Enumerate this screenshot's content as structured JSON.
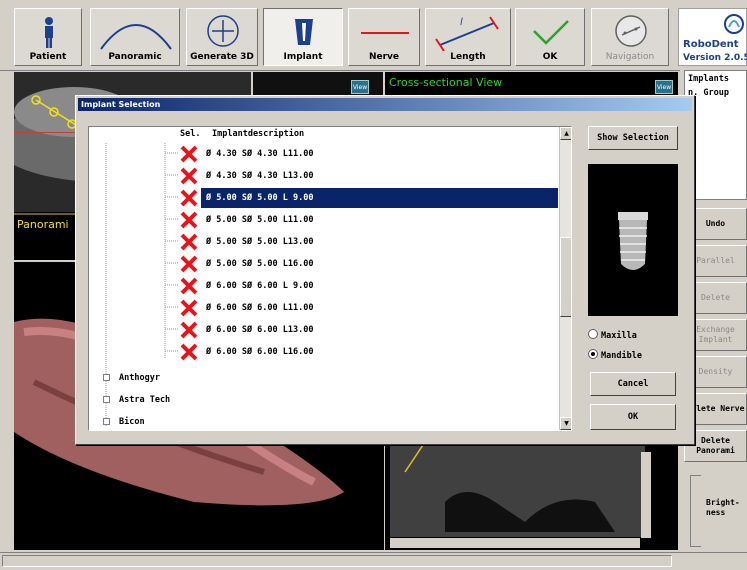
{
  "toolbar": {
    "buttons": [
      {
        "label": "Patient",
        "icon": "person-icon"
      },
      {
        "label": "Panoramic",
        "icon": "arch-curve-icon"
      },
      {
        "label": "Generate 3D",
        "icon": "crosshair-circle-icon"
      },
      {
        "label": "Implant",
        "icon": "implant-icon"
      },
      {
        "label": "Nerve",
        "icon": "red-line-icon"
      },
      {
        "label": "Length",
        "icon": "ruler-line-icon"
      },
      {
        "label": "OK",
        "icon": "checkmark-icon"
      },
      {
        "label": "Navigation",
        "icon": "navigation-icon"
      }
    ]
  },
  "brand": {
    "name": "RoboDent",
    "version": "Version 2.0.5"
  },
  "views": {
    "panoramic_label": "Panorami",
    "cross_sectional_label": "Cross-sectional View",
    "view_button": "View"
  },
  "right_panel": {
    "implants_header": "Implants",
    "group_label": "n. Group",
    "buttons": [
      "Undo",
      "Parallel",
      "Delete",
      "Exchange Implant",
      "Density",
      "Delete Nerve",
      "Delete Panorami"
    ],
    "brightness_label": "Bright- ness"
  },
  "dialog": {
    "title": "Implant Selection",
    "column_sel": "Sel.",
    "column_desc": "Implantdescription",
    "rows": [
      "Ø 4.30 SØ 4.30 L11.00",
      "Ø 4.30 SØ 4.30 L13.00",
      "Ø 5.00 SØ 5.00 L 9.00",
      "Ø 5.00 SØ 5.00 L11.00",
      "Ø 5.00 SØ 5.00 L13.00",
      "Ø 5.00 SØ 5.00 L16.00",
      "Ø 6.00 SØ 6.00 L 9.00",
      "Ø 6.00 SØ 6.00 L11.00",
      "Ø 6.00 SØ 6.00 L13.00",
      "Ø 6.00 SØ 6.00 L16.00"
    ],
    "selected_row": 2,
    "groups": [
      "Anthogyr",
      "Astra Tech",
      "Bicon"
    ],
    "show_selection": "Show Selection",
    "maxilla": "Maxilla",
    "mandible": "Mandible",
    "cancel": "Cancel",
    "ok": "OK"
  },
  "colors": {
    "selection": "#0a246a",
    "x_mark": "#e8141b",
    "accent_green": "#2ed52e",
    "brand_blue": "#1d3f8f"
  }
}
